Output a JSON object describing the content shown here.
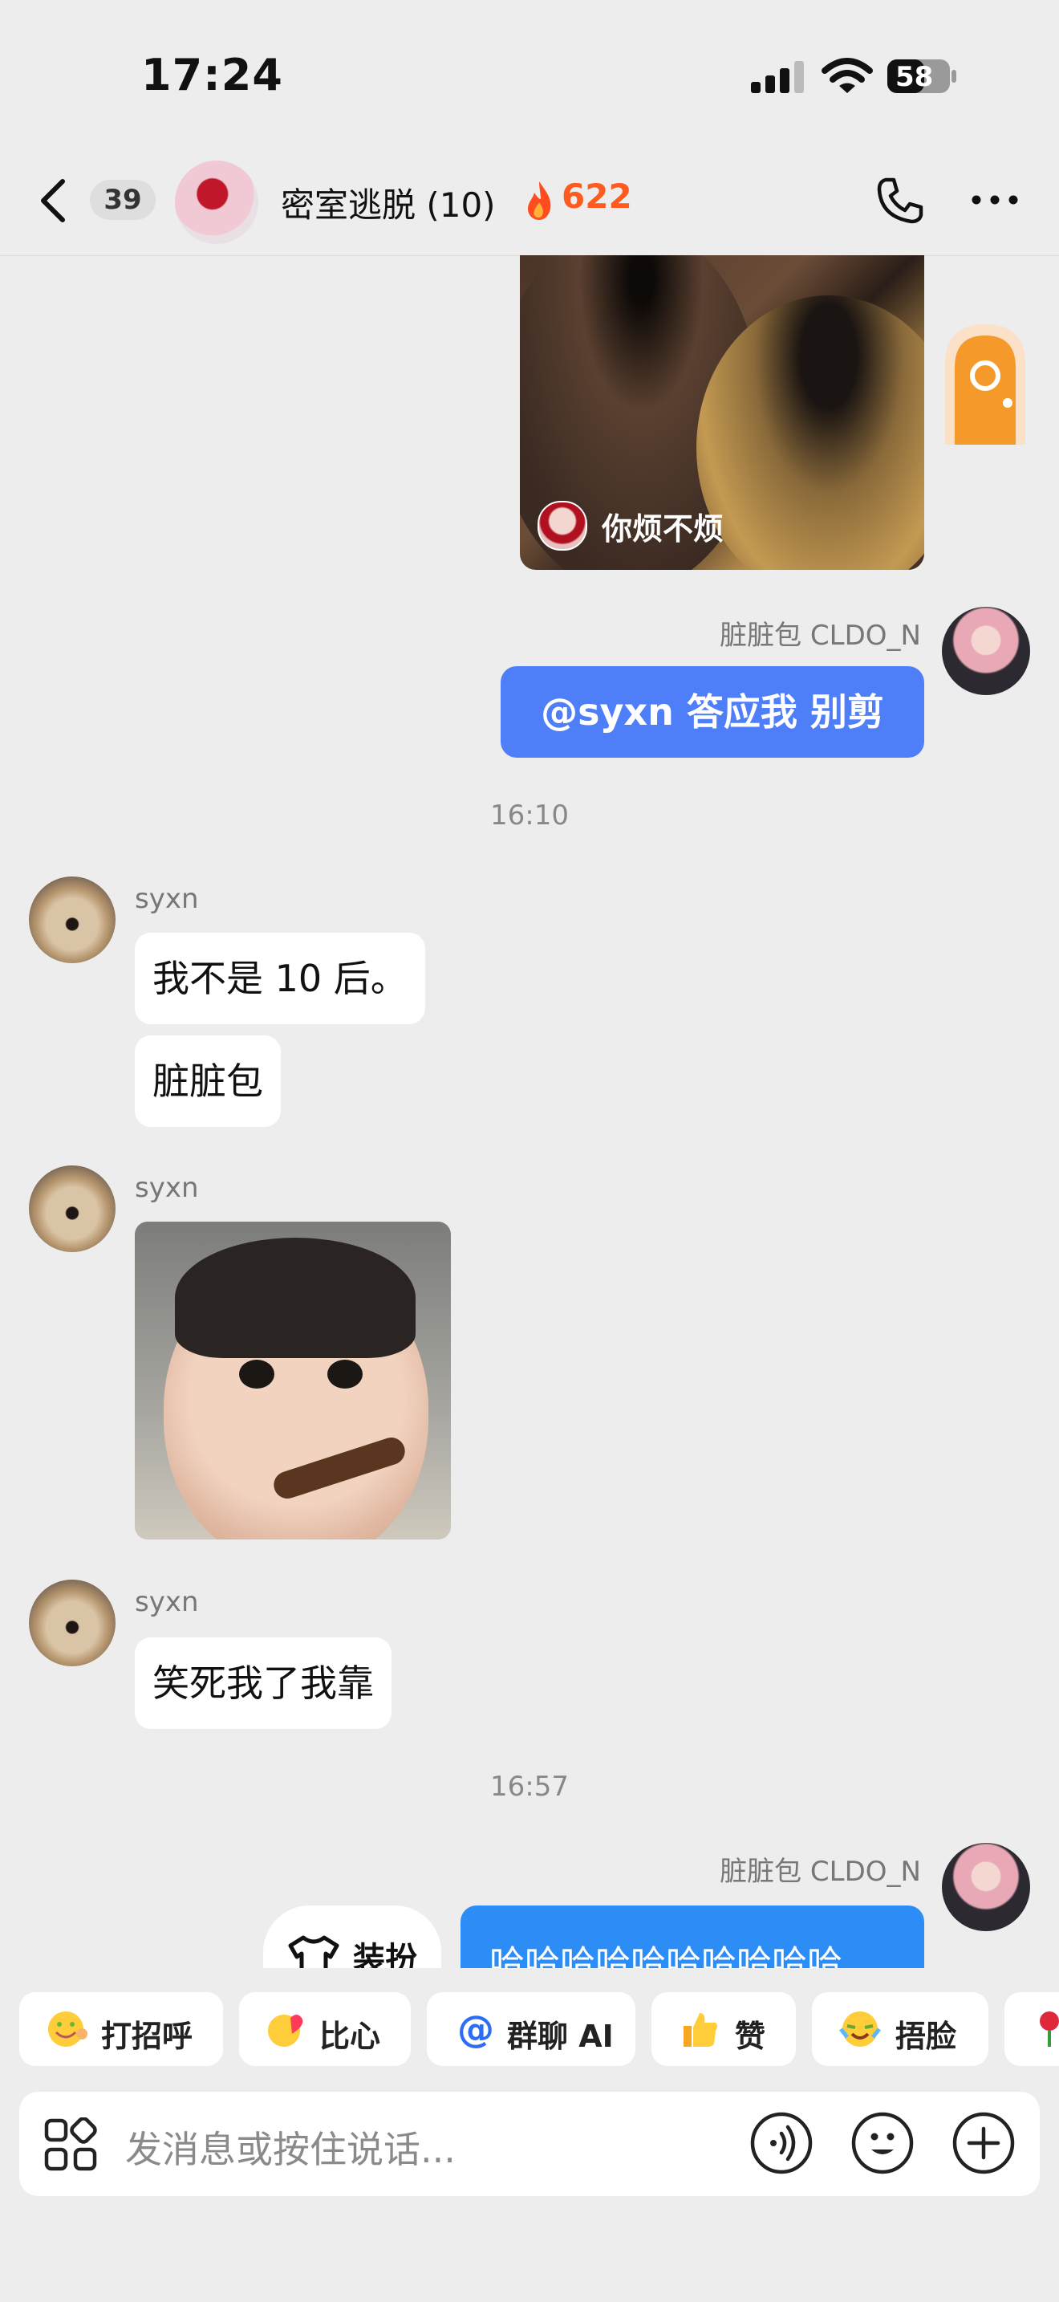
{
  "status": {
    "time": "17:24",
    "battery": "58"
  },
  "header": {
    "unread_count": "39",
    "title": "密室逃脱 (10)",
    "streak": "622"
  },
  "messages": {
    "image_caption": "你烦不烦",
    "sender_right": "脏脏包 CLDO_N",
    "reply_right": "@syxn 答应我 别剪",
    "time1": "16:10",
    "sender_left": "syxn",
    "msg1": "我不是 10 后。",
    "msg2": "脏脏包",
    "msg3": "笑死我了我靠",
    "time2": "16:57",
    "sender_right2": "脏脏包 CLDO_N",
    "dress_up_label": "装扮",
    "last_right": "哈哈哈哈哈哈哈哈哈哈"
  },
  "quick_replies": [
    "打招呼",
    "比心",
    "群聊 AI",
    "赞",
    "捂脸"
  ],
  "quick_reply_icons": [
    "smile-icon",
    "heart-hand-icon",
    "at-icon",
    "thumbs-up-icon",
    "facepalm-icon",
    "rose-icon"
  ],
  "input": {
    "placeholder": "发消息或按住说话..."
  },
  "colors": {
    "blue_bubble": "#4f7ef9",
    "bright_blue_bubble": "#2d8df6",
    "streak_orange": "#ff5a1f",
    "background": "#ededed"
  }
}
